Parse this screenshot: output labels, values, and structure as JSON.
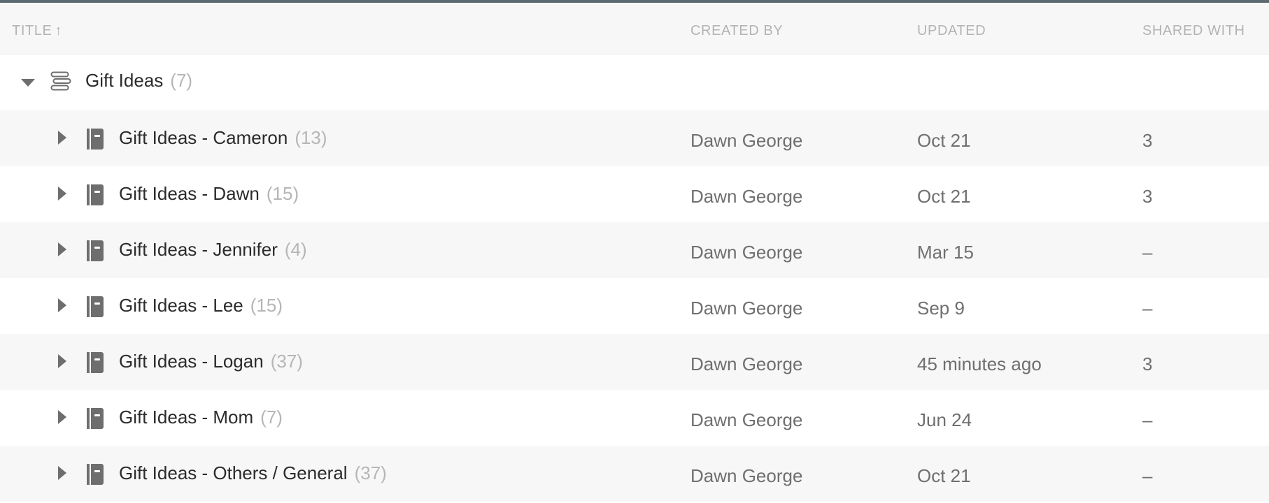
{
  "header": {
    "columns": {
      "title": "Title",
      "sort_indicator": "↑",
      "created_by": "Created By",
      "updated": "Updated",
      "shared_with": "Shared With"
    }
  },
  "icons": {
    "group": "stack-icon",
    "item": "notebook-icon",
    "expanded": "caret-down-icon",
    "collapsed": "caret-right-icon",
    "sort": "arrow-up-icon"
  },
  "group": {
    "title": "Gift Ideas",
    "count": "(7)",
    "expanded": true
  },
  "rows": [
    {
      "title": "Gift Ideas - Cameron",
      "count": "(13)",
      "created_by": "Dawn George",
      "updated": "Oct 21",
      "shared_with": "3"
    },
    {
      "title": "Gift Ideas - Dawn",
      "count": "(15)",
      "created_by": "Dawn George",
      "updated": "Oct 21",
      "shared_with": "3"
    },
    {
      "title": "Gift Ideas - Jennifer",
      "count": "(4)",
      "created_by": "Dawn George",
      "updated": "Mar 15",
      "shared_with": "–"
    },
    {
      "title": "Gift Ideas - Lee",
      "count": "(15)",
      "created_by": "Dawn George",
      "updated": "Sep 9",
      "shared_with": "–"
    },
    {
      "title": "Gift Ideas - Logan",
      "count": "(37)",
      "created_by": "Dawn George",
      "updated": "45 minutes ago",
      "shared_with": "3"
    },
    {
      "title": "Gift Ideas - Mom",
      "count": "(7)",
      "created_by": "Dawn George",
      "updated": "Jun 24",
      "shared_with": "–"
    },
    {
      "title": "Gift Ideas - Others / General",
      "count": "(37)",
      "created_by": "Dawn George",
      "updated": "Oct 21",
      "shared_with": "–"
    }
  ],
  "colors": {
    "topbar": "#5b6b71",
    "header_bg": "#f7f7f7",
    "alt_row_bg": "#f7f7f7",
    "primary_text": "#2b2b2b",
    "secondary_text": "#6f6f6f",
    "muted_text": "#b4b4b4",
    "icon": "#6e6e6e"
  }
}
